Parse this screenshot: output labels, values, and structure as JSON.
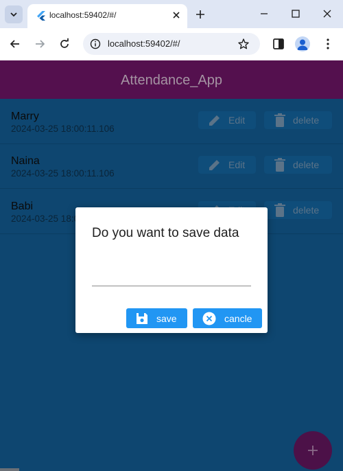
{
  "browser": {
    "tab_title": "localhost:59402/#/",
    "url": "localhost:59402/#/",
    "icons": [
      "tab-search-icon",
      "flutter-icon",
      "close-icon",
      "plus-icon",
      "minimize-icon",
      "maximize-icon",
      "close-window-icon",
      "back-arrow-icon",
      "forward-arrow-icon",
      "reload-icon",
      "info-icon",
      "star-icon",
      "side-panel-icon",
      "profile-icon",
      "more-vert-icon"
    ]
  },
  "app": {
    "title": "Attendance_App",
    "colors": {
      "appbar": "#54104e",
      "background": "#0e4670",
      "fab": "#4c1148",
      "dialog_button": "#2196f3"
    }
  },
  "records": [
    {
      "name": "Marry",
      "timestamp": "2024-03-25 18:00:11.106",
      "edit_label": "Edit",
      "delete_label": "delete"
    },
    {
      "name": "Naina",
      "timestamp": "2024-03-25 18:00:11.106",
      "edit_label": "Edit",
      "delete_label": "delete"
    },
    {
      "name": "Babi",
      "timestamp": "2024-03-25 18:00:11.106",
      "edit_label": "Edit",
      "delete_label": "delete"
    }
  ],
  "fab": {
    "icon": "plus-icon"
  },
  "dialog": {
    "title": "Do you want to save data",
    "input_value": "",
    "save_label": "save",
    "cancel_label": "cancle",
    "icons": [
      "save-icon",
      "cancel-circle-icon"
    ]
  }
}
